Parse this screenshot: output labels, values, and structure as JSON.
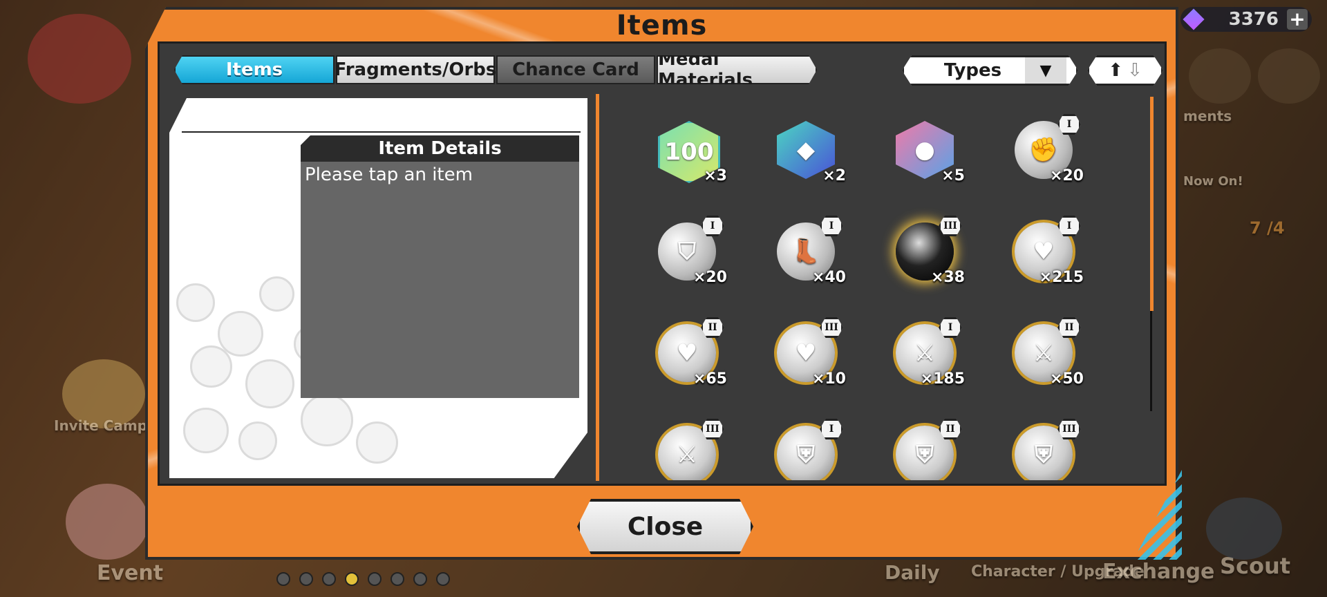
{
  "currency": {
    "amount": "3376",
    "icon": "gem-icon"
  },
  "background": {
    "invite_label": "Invite Campaign",
    "event_label": "Event",
    "daily_label": "Daily",
    "character_label": "Character / Upgrade",
    "exchange_label": "Exchange",
    "scout_label": "Scout",
    "ments_label": "ments",
    "now_on_label": "Now On!",
    "counter": "7 /4"
  },
  "dialog": {
    "title": "Items",
    "tabs": [
      {
        "label": "Items",
        "active": true
      },
      {
        "label": "Fragments/Orbs",
        "active": false
      },
      {
        "label": "Chance Card",
        "active": false
      },
      {
        "label": "Medal Materials",
        "active": false
      }
    ],
    "filter_label": "Types",
    "detail_title": "Item Details",
    "detail_text": "Please tap an item",
    "close_label": "Close"
  },
  "items": [
    {
      "icon": "yellow-100-ticket-icon",
      "qty": "×3",
      "rank": ""
    },
    {
      "icon": "blue-gem-ticket-icon",
      "qty": "×2",
      "rank": ""
    },
    {
      "icon": "pink-character-ticket-icon",
      "qty": "×5",
      "rank": ""
    },
    {
      "icon": "fist-booster-icon",
      "qty": "×20",
      "rank": "I"
    },
    {
      "icon": "shield-booster-icon",
      "qty": "×20",
      "rank": "I"
    },
    {
      "icon": "boot-booster-icon",
      "qty": "×40",
      "rank": "I"
    },
    {
      "icon": "black-orb-icon",
      "qty": "×38",
      "rank": "III"
    },
    {
      "icon": "heart-medal-icon",
      "qty": "×215",
      "rank": "I"
    },
    {
      "icon": "heart-medal-icon",
      "qty": "×65",
      "rank": "II"
    },
    {
      "icon": "heart-medal-icon",
      "qty": "×10",
      "rank": "III"
    },
    {
      "icon": "sword-medal-icon",
      "qty": "×185",
      "rank": "I"
    },
    {
      "icon": "sword-medal-icon",
      "qty": "×50",
      "rank": "II"
    },
    {
      "icon": "sword-medal-icon",
      "qty": "",
      "rank": "III"
    },
    {
      "icon": "armor-medal-icon",
      "qty": "",
      "rank": "I"
    },
    {
      "icon": "armor-medal-icon",
      "qty": "",
      "rank": "II"
    },
    {
      "icon": "armor-medal-icon",
      "qty": "",
      "rank": "III"
    }
  ],
  "page_dots": {
    "count": 8,
    "active_index": 3
  }
}
